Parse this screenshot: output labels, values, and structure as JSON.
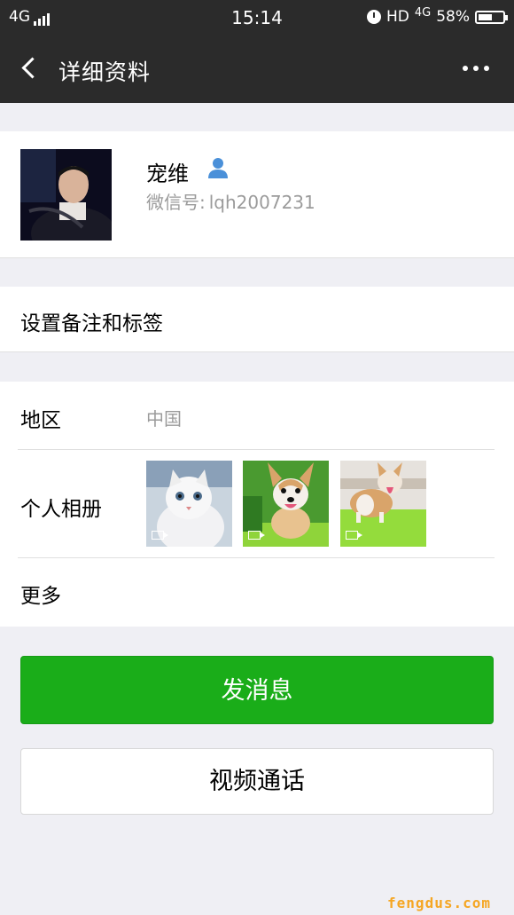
{
  "status_bar": {
    "network": "4G",
    "time": "15:14",
    "hd": "HD",
    "net_type": "4G",
    "battery": "58%",
    "battery_level": 0.58
  },
  "nav": {
    "title": "详细资料",
    "back_icon": "chevron-left-icon",
    "more_icon": "more-dots-icon"
  },
  "profile": {
    "name": "宠维",
    "wechat_id_label": "微信号:",
    "wechat_id": "lqh2007231"
  },
  "remark": {
    "label": "设置备注和标签"
  },
  "details": {
    "region_label": "地区",
    "region_value": "中国",
    "album_label": "个人相册",
    "more_label": "更多"
  },
  "actions": {
    "send_message": "发消息",
    "video_call": "视频通话"
  },
  "watermark": "fengdus.com",
  "colors": {
    "header_bg": "#2b2b2b",
    "page_bg": "#efeff4",
    "primary_green": "#1aad19",
    "contact_icon": "#4a90d9"
  }
}
